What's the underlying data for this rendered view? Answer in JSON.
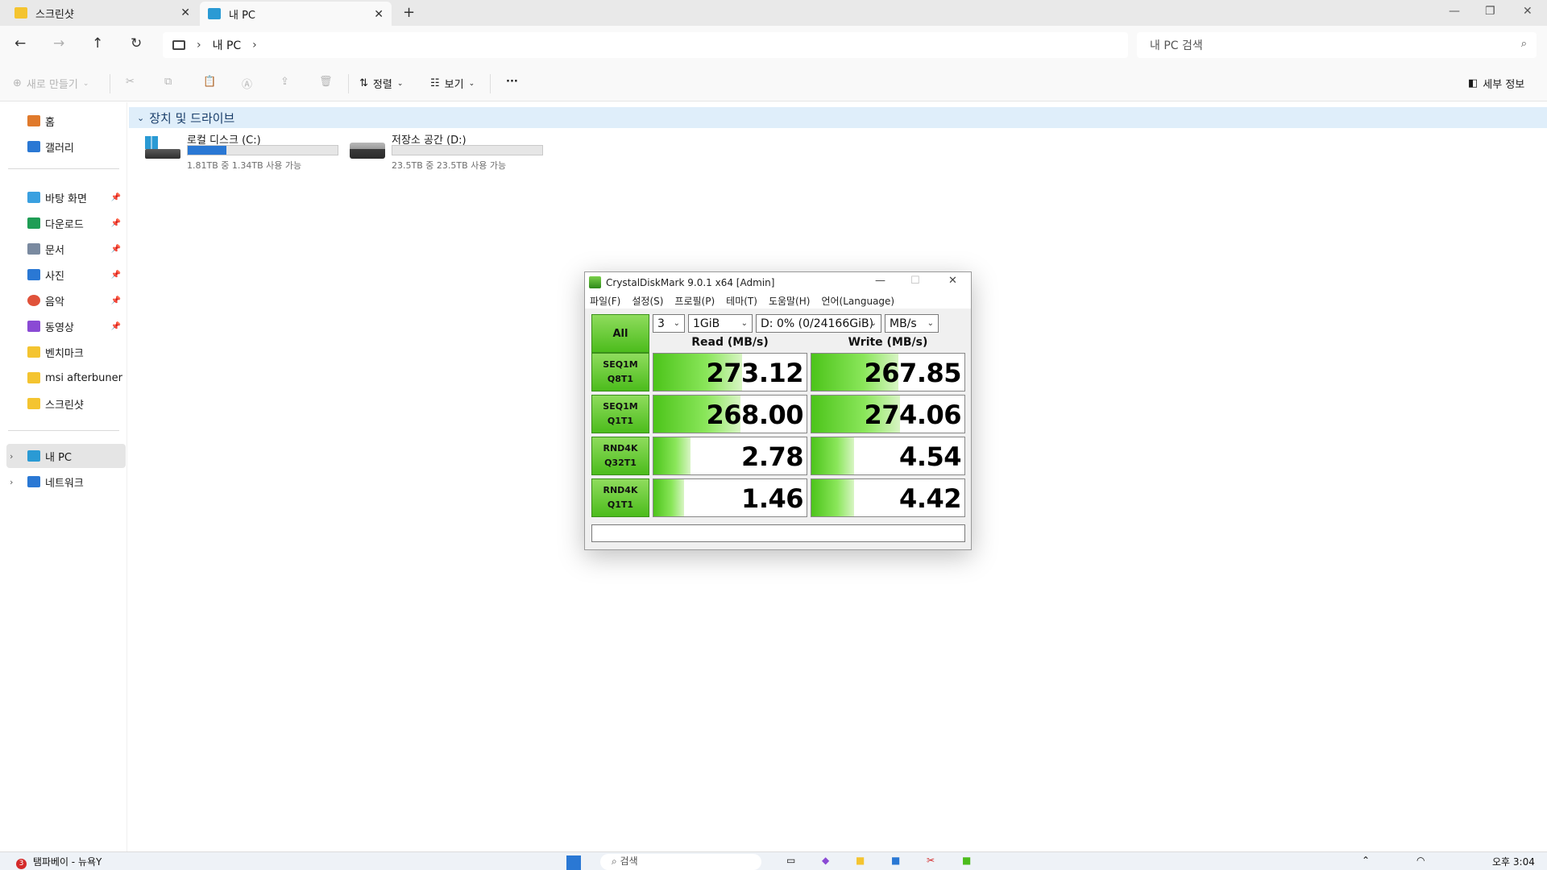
{
  "tabs": [
    {
      "label": "스크린샷",
      "icon": "folder-icon"
    },
    {
      "label": "내 PC",
      "icon": "monitor-icon"
    }
  ],
  "address": {
    "segment": "내 PC",
    "search_placeholder": "내 PC 검색"
  },
  "commands": {
    "new": "새로 만들기",
    "sort": "정렬",
    "view": "보기",
    "more": "···",
    "details": "세부 정보"
  },
  "sidebar": {
    "quick": [
      {
        "label": "홈",
        "icon": "home-icon",
        "color": "#e07a2c"
      },
      {
        "label": "갤러리",
        "icon": "gallery-icon",
        "color": "#2a78d4"
      }
    ],
    "pinned": [
      {
        "label": "바탕 화면",
        "icon": "desktop-icon",
        "color": "#3aa0e0"
      },
      {
        "label": "다운로드",
        "icon": "download-icon",
        "color": "#1f9d55"
      },
      {
        "label": "문서",
        "icon": "document-icon",
        "color": "#7a8aa0"
      },
      {
        "label": "사진",
        "icon": "pictures-icon",
        "color": "#2a78d4"
      },
      {
        "label": "음악",
        "icon": "music-icon",
        "color": "#e0523a"
      },
      {
        "label": "동영상",
        "icon": "video-icon",
        "color": "#8a4ad4"
      },
      {
        "label": "벤치마크",
        "icon": "folder-icon",
        "color": "#f4c430"
      },
      {
        "label": "msi afterbuner ben",
        "icon": "folder-icon",
        "color": "#f4c430"
      },
      {
        "label": "스크린샷",
        "icon": "folder-icon",
        "color": "#f4c430"
      }
    ],
    "tree": [
      {
        "label": "내 PC",
        "icon": "monitor-icon",
        "color": "#2a9ad4"
      },
      {
        "label": "네트워크",
        "icon": "network-icon",
        "color": "#2a78d4"
      }
    ]
  },
  "content": {
    "group_title": "장치 및 드라이브",
    "drives": [
      {
        "name": "로컬 디스크 (C:)",
        "size": "1.81TB 중 1.34TB 사용 가능",
        "used_fraction": 0.26
      },
      {
        "name": "저장소 공간 (D:)",
        "size": "23.5TB 중 23.5TB 사용 가능",
        "used_fraction": 0.0
      }
    ]
  },
  "cdm": {
    "title": "CrystalDiskMark 9.0.1 x64 [Admin]",
    "menu": [
      "파일(F)",
      "설정(S)",
      "프로필(P)",
      "테마(T)",
      "도움말(H)",
      "언어(Language)"
    ],
    "all_button": "All",
    "count": "3",
    "size": "1GiB",
    "drive": "D: 0% (0/24166GiB)",
    "unit": "MB/s",
    "read_header": "Read (MB/s)",
    "write_header": "Write (MB/s)",
    "rows": [
      {
        "line1": "SEQ1M",
        "line2": "Q8T1",
        "read": "273.12",
        "write": "267.85",
        "read_fill": 0.58,
        "write_fill": 0.57
      },
      {
        "line1": "SEQ1M",
        "line2": "Q1T1",
        "read": "268.00",
        "write": "274.06",
        "read_fill": 0.57,
        "write_fill": 0.58
      },
      {
        "line1": "RND4K",
        "line2": "Q32T1",
        "read": "2.78",
        "write": "4.54",
        "read_fill": 0.24,
        "write_fill": 0.28
      },
      {
        "line1": "RND4K",
        "line2": "Q1T1",
        "read": "1.46",
        "write": "4.42",
        "read_fill": 0.2,
        "write_fill": 0.28
      }
    ]
  },
  "taskbar": {
    "news": "탬파베이 - 뉴욕Y",
    "badge": "3",
    "search": "검색",
    "clock": "오후 3:04"
  }
}
